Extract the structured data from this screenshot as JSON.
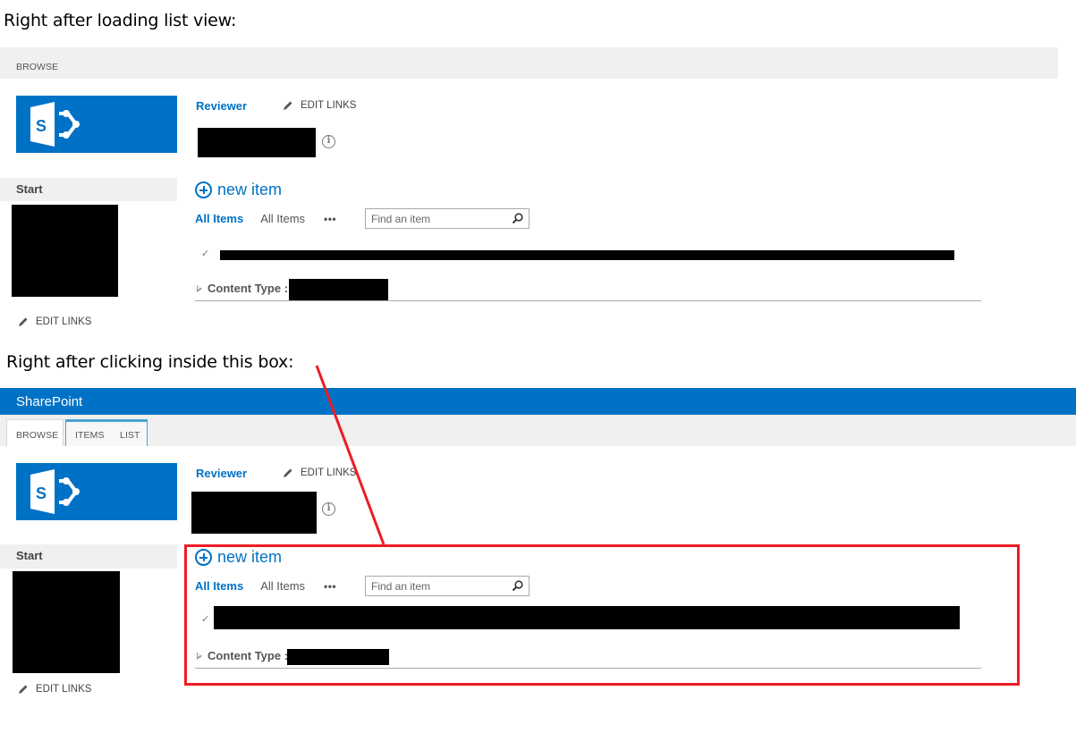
{
  "captions": {
    "before": "Right after loading list view:",
    "after": "Right after clicking inside this box:"
  },
  "colors": {
    "brand_blue": "#0072c6",
    "ribbon_gray": "#f0f0f0",
    "annotation_red": "#ed1c24"
  },
  "suite_bar": {
    "title": "SharePoint"
  },
  "ribbon": {
    "tabs": [
      {
        "label": "BROWSE",
        "selected": true
      },
      {
        "label": "ITEMS",
        "contextual": true
      },
      {
        "label": "LIST",
        "contextual": true
      }
    ]
  },
  "site": {
    "logo_icon": "sharepoint-logo-icon",
    "breadcrumb_link": "Reviewer",
    "edit_links_label": "EDIT LINKS",
    "info_icon": "info-icon",
    "page_title": "[redacted]"
  },
  "quick_launch": {
    "start_label": "Start",
    "edit_links_label": "EDIT LINKS"
  },
  "list": {
    "new_item_label": "new item",
    "views": [
      {
        "label": "All Items",
        "active": true
      },
      {
        "label": "All Items",
        "active": false
      }
    ],
    "more_label": "•••",
    "search_placeholder": "Find an item",
    "search_icon": "magnifier-icon",
    "select_all_glyph": "✓",
    "group_label": "Content Type :",
    "group_value": "[redacted]"
  }
}
